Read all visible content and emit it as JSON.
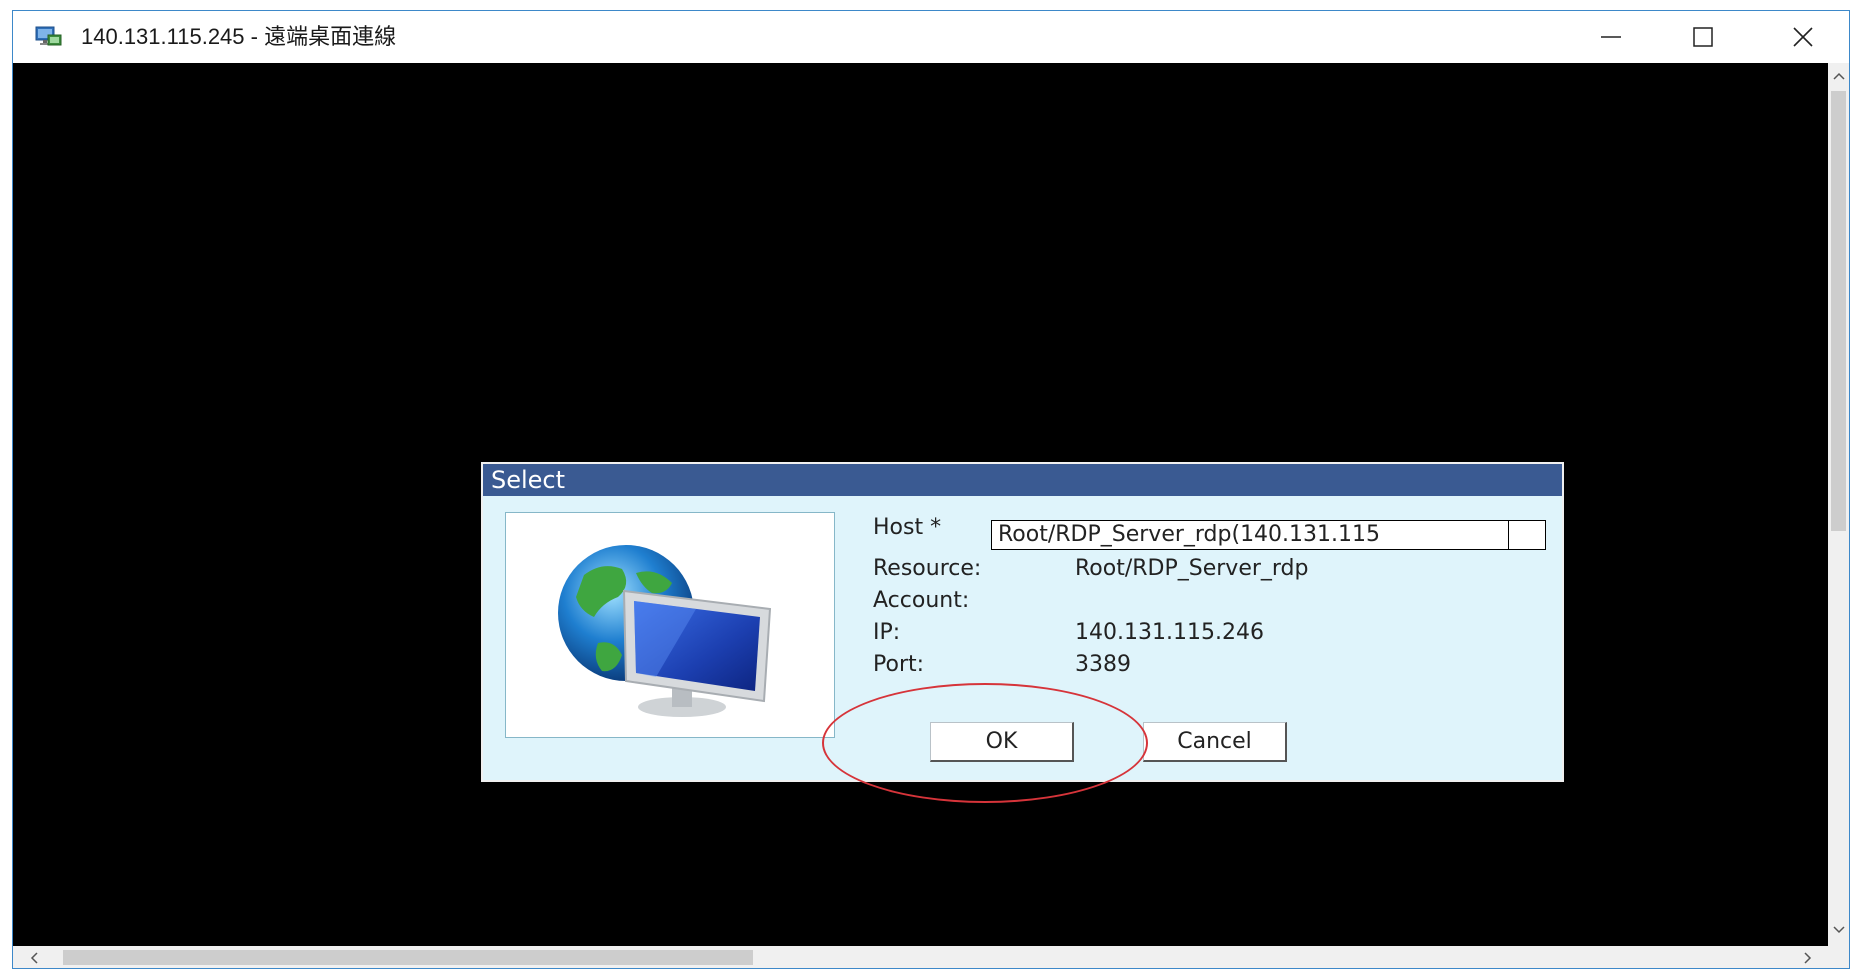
{
  "window": {
    "title": "140.131.115.245 - 遠端桌面連線",
    "icon": "remote-desktop-icon",
    "accent_color": "#3d88c9"
  },
  "dialog": {
    "title": "Select",
    "title_color": "#3a5a92",
    "background_color": "#dff4fb",
    "image": "globe-monitor-icon",
    "host_label": "Host *",
    "host_value": "Root/RDP_Server_rdp(140.131.115",
    "resource_label": "Resource:",
    "resource_value": "Root/RDP_Server_rdp",
    "account_label": "Account:",
    "account_value": "",
    "ip_label": "IP:",
    "ip_value": "140.131.115.246",
    "port_label": "Port:",
    "port_value": "3389",
    "ok_label": "OK",
    "cancel_label": "Cancel"
  },
  "annotation": {
    "color": "#d6343a",
    "target": "ok-button"
  }
}
